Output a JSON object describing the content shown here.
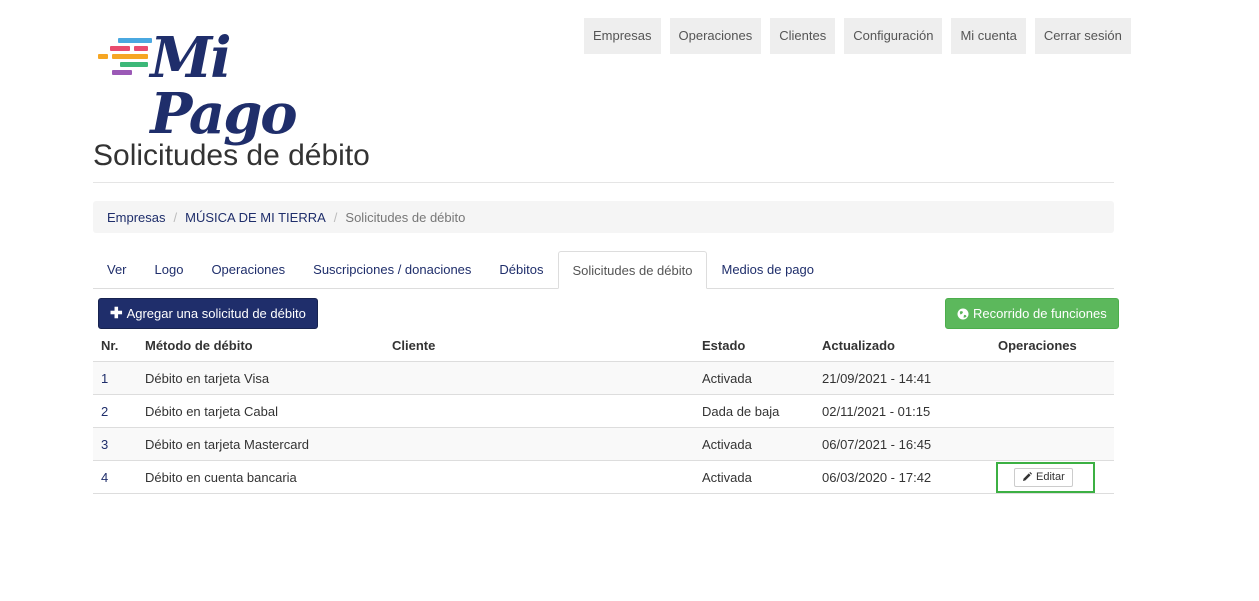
{
  "brand": {
    "name": "Mi Pago",
    "bar_colors": [
      "#4aa8e0",
      "#e94c6f",
      "#f6a623",
      "#3cb878",
      "#9b59b6"
    ]
  },
  "topnav": {
    "items": [
      {
        "label": "Empresas"
      },
      {
        "label": "Operaciones"
      },
      {
        "label": "Clientes"
      },
      {
        "label": "Configuración"
      },
      {
        "label": "Mi cuenta"
      },
      {
        "label": "Cerrar sesión"
      }
    ]
  },
  "page": {
    "title": "Solicitudes de débito"
  },
  "breadcrumb": {
    "items": [
      "Empresas",
      "MÚSICA DE MI TIERRA",
      "Solicitudes de débito"
    ]
  },
  "tabs": {
    "items": [
      {
        "label": "Ver"
      },
      {
        "label": "Logo"
      },
      {
        "label": "Operaciones"
      },
      {
        "label": "Suscripciones / donaciones"
      },
      {
        "label": "Débitos"
      },
      {
        "label": "Solicitudes de débito",
        "active": true
      },
      {
        "label": "Medios de pago"
      }
    ]
  },
  "actions": {
    "add_label": "Agregar una solicitud de débito",
    "tour_label": "Recorrido de funciones"
  },
  "table": {
    "headers": {
      "nr": "Nr.",
      "method": "Método de débito",
      "client": "Cliente",
      "status": "Estado",
      "updated": "Actualizado",
      "operations": "Operaciones"
    },
    "rows": [
      {
        "nr": "1",
        "method": "Débito en tarjeta Visa",
        "client": "",
        "status": "Activada",
        "updated": "21/09/2021 - 14:41"
      },
      {
        "nr": "2",
        "method": "Débito en tarjeta Cabal",
        "client": "",
        "status": "Dada de baja",
        "updated": "02/11/2021 - 01:15"
      },
      {
        "nr": "3",
        "method": "Débito en tarjeta Mastercard",
        "client": "",
        "status": "Activada",
        "updated": "06/07/2021 - 16:45"
      },
      {
        "nr": "4",
        "method": "Débito en cuenta bancaria",
        "client": "",
        "status": "Activada",
        "updated": "06/03/2020 - 17:42",
        "edit_label": "Editar"
      }
    ]
  },
  "colors": {
    "primary": "#1f2e6b",
    "success": "#5cb85c",
    "highlight": "#3cb043"
  }
}
